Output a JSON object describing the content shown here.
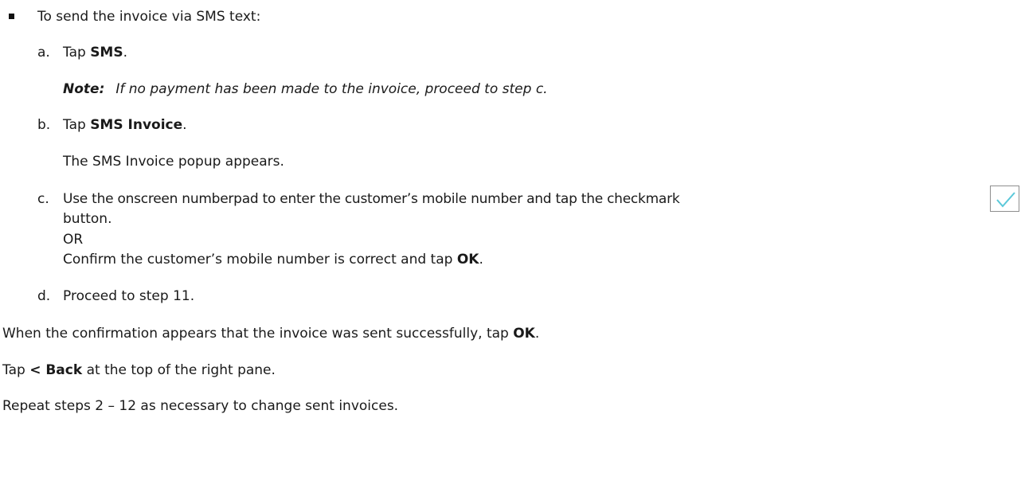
{
  "intro": "To send the invoice via SMS text:",
  "step_a": {
    "marker": "a.",
    "pre": "Tap ",
    "bold": "SMS",
    "post": "."
  },
  "note": {
    "label": "Note:",
    "text": "If no payment has been made to the invoice, proceed to step c."
  },
  "step_b": {
    "marker": "b.",
    "pre": "Tap ",
    "bold": "SMS Invoice",
    "post": "."
  },
  "step_b_result": "The SMS Invoice popup appears.",
  "step_c": {
    "marker": "c.",
    "line1": "Use the onscreen numberpad to enter the customer’s mobile number and tap the checkmark",
    "line2": "button.",
    "or": "OR",
    "confirm_pre": "Confirm the customer’s mobile number is correct and tap ",
    "confirm_bold": "OK",
    "confirm_post": "."
  },
  "step_d": {
    "marker": "d.",
    "text": "Proceed to step 11."
  },
  "para_confirm": {
    "pre": "When the confirmation appears that the invoice was sent successfully, tap ",
    "bold": "OK",
    "post": "."
  },
  "para_back": {
    "pre": "Tap ",
    "bold": "< Back",
    "post": " at the top of the right pane."
  },
  "para_repeat": "Repeat steps 2 – 12 as necessary to change sent invoices.",
  "icon_color": "#5bc8d9"
}
